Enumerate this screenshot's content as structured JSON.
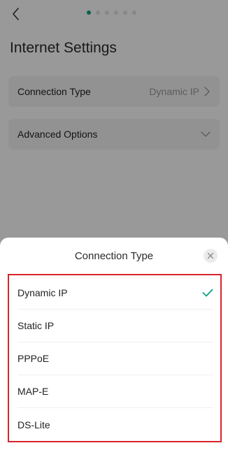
{
  "header": {
    "back_icon": "chevron-left-icon",
    "pager": {
      "total": 6,
      "active_index": 0,
      "active_color": "#10a37f"
    },
    "title": "Internet Settings"
  },
  "settings": {
    "connection_type": {
      "label": "Connection Type",
      "value": "Dynamic IP"
    },
    "advanced_options": {
      "label": "Advanced Options"
    }
  },
  "sheet": {
    "title": "Connection Type",
    "close_icon": "close-icon",
    "selected": "Dynamic IP",
    "check_color": "#10a37f",
    "highlight_color": "#d8232a",
    "options": [
      {
        "label": "Dynamic IP",
        "selected": true
      },
      {
        "label": "Static IP",
        "selected": false
      },
      {
        "label": "PPPoE",
        "selected": false
      },
      {
        "label": "MAP-E",
        "selected": false
      },
      {
        "label": "DS-Lite",
        "selected": false
      }
    ]
  }
}
